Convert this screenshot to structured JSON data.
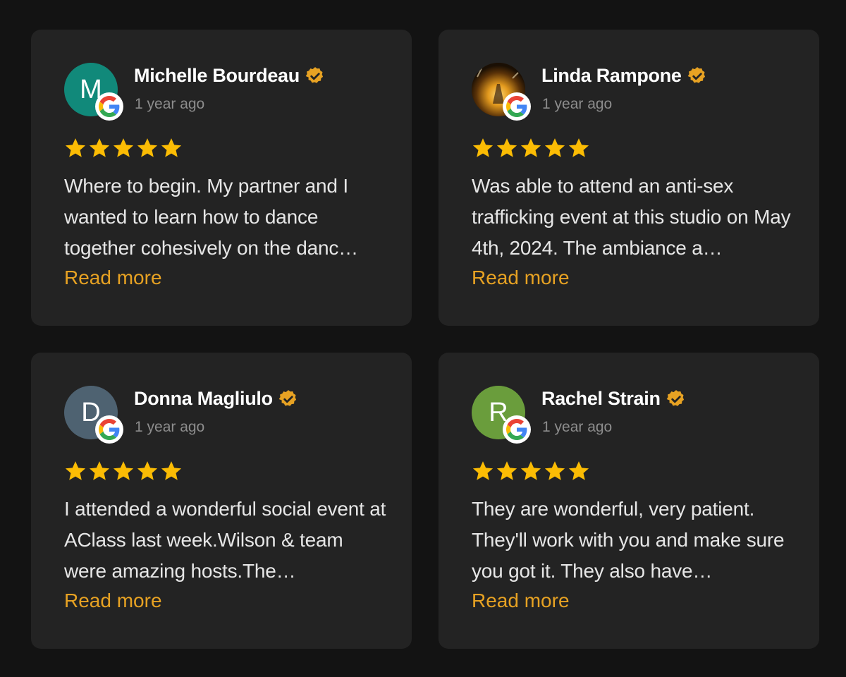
{
  "colors": {
    "background": "#131313",
    "card": "#232323",
    "star": "#fbbc04",
    "verified": "#e7a223",
    "read_more": "#e7a223"
  },
  "reviews": [
    {
      "initial": "M",
      "avatar_color": "#11897a",
      "avatar_type": "initial",
      "name": "Michelle Bourdeau",
      "time": "1 year ago",
      "rating": 5,
      "text": "Where to begin. My partner and I wanted to learn how to dance together cohesively on the danc…",
      "read_more": "Read more"
    },
    {
      "initial": "",
      "avatar_color": "#2a1a08",
      "avatar_type": "photo",
      "name": "Linda Rampone",
      "time": "1 year ago",
      "rating": 5,
      "text": "Was able to attend an anti-sex trafficking event at this studio on May 4th, 2024. The ambiance a…",
      "read_more": "Read more"
    },
    {
      "initial": "D",
      "avatar_color": "#4e6271",
      "avatar_type": "initial",
      "name": "Donna Magliulo",
      "time": "1 year ago",
      "rating": 5,
      "text": "I attended a wonderful social event at AClass last week.Wilson & team were amazing hosts.The…",
      "read_more": "Read more"
    },
    {
      "initial": "R",
      "avatar_color": "#6a9d3c",
      "avatar_type": "initial",
      "name": "Rachel Strain",
      "time": "1 year ago",
      "rating": 5,
      "text": "They are wonderful, very patient. They'll work with you and make sure you got it. They also have…",
      "read_more": "Read more"
    }
  ]
}
